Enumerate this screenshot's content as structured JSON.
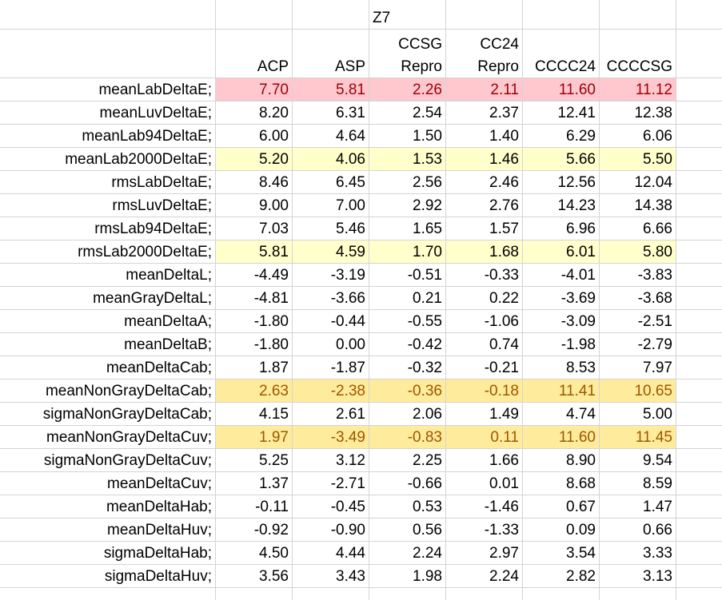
{
  "sheet": {
    "top_header": "Z7",
    "columns": [
      {
        "line1": "",
        "line2": "ACP"
      },
      {
        "line1": "",
        "line2": "ASP"
      },
      {
        "line1": "CCSG",
        "line2": "Repro"
      },
      {
        "line1": "CC24",
        "line2": "Repro"
      },
      {
        "line1": "",
        "line2": "CCCC24"
      },
      {
        "line1": "",
        "line2": "CCCCSG"
      }
    ],
    "rows": [
      {
        "label": "meanLabDeltaE;",
        "highlight": "pink",
        "values": [
          "7.70",
          "5.81",
          "2.26",
          "2.11",
          "11.60",
          "11.12"
        ]
      },
      {
        "label": "meanLuvDeltaE;",
        "highlight": "",
        "values": [
          "8.20",
          "6.31",
          "2.54",
          "2.37",
          "12.41",
          "12.38"
        ]
      },
      {
        "label": "meanLab94DeltaE;",
        "highlight": "",
        "values": [
          "6.00",
          "4.64",
          "1.50",
          "1.40",
          "6.29",
          "6.06"
        ]
      },
      {
        "label": "meanLab2000DeltaE;",
        "highlight": "yellow",
        "values": [
          "5.20",
          "4.06",
          "1.53",
          "1.46",
          "5.66",
          "5.50"
        ]
      },
      {
        "label": "rmsLabDeltaE;",
        "highlight": "",
        "values": [
          "8.46",
          "6.45",
          "2.56",
          "2.46",
          "12.56",
          "12.04"
        ]
      },
      {
        "label": "rmsLuvDeltaE;",
        "highlight": "",
        "values": [
          "9.00",
          "7.00",
          "2.92",
          "2.76",
          "14.23",
          "14.38"
        ]
      },
      {
        "label": "rmsLab94DeltaE;",
        "highlight": "",
        "values": [
          "7.03",
          "5.46",
          "1.65",
          "1.57",
          "6.96",
          "6.66"
        ]
      },
      {
        "label": "rmsLab2000DeltaE;",
        "highlight": "yellow",
        "values": [
          "5.81",
          "4.59",
          "1.70",
          "1.68",
          "6.01",
          "5.80"
        ]
      },
      {
        "label": "meanDeltaL;",
        "highlight": "",
        "values": [
          "-4.49",
          "-3.19",
          "-0.51",
          "-0.33",
          "-4.01",
          "-3.83"
        ]
      },
      {
        "label": "meanGrayDeltaL;",
        "highlight": "",
        "values": [
          "-4.81",
          "-3.66",
          "0.21",
          "0.22",
          "-3.69",
          "-3.68"
        ]
      },
      {
        "label": "meanDeltaA;",
        "highlight": "",
        "values": [
          "-1.80",
          "-0.44",
          "-0.55",
          "-1.06",
          "-3.09",
          "-2.51"
        ]
      },
      {
        "label": "meanDeltaB;",
        "highlight": "",
        "values": [
          "-1.80",
          "0.00",
          "-0.42",
          "0.74",
          "-1.98",
          "-2.79"
        ]
      },
      {
        "label": "meanDeltaCab;",
        "highlight": "",
        "values": [
          "1.87",
          "-1.87",
          "-0.32",
          "-0.21",
          "8.53",
          "7.97"
        ]
      },
      {
        "label": "meanNonGrayDeltaCab;",
        "highlight": "gold",
        "values": [
          "2.63",
          "-2.38",
          "-0.36",
          "-0.18",
          "11.41",
          "10.65"
        ]
      },
      {
        "label": "sigmaNonGrayDeltaCab;",
        "highlight": "",
        "values": [
          "4.15",
          "2.61",
          "2.06",
          "1.49",
          "4.74",
          "5.00"
        ]
      },
      {
        "label": "meanNonGrayDeltaCuv;",
        "highlight": "gold",
        "values": [
          "1.97",
          "-3.49",
          "-0.83",
          "0.11",
          "11.60",
          "11.45"
        ]
      },
      {
        "label": "sigmaNonGrayDeltaCuv;",
        "highlight": "",
        "values": [
          "5.25",
          "3.12",
          "2.25",
          "1.66",
          "8.90",
          "9.54"
        ]
      },
      {
        "label": "meanDeltaCuv;",
        "highlight": "",
        "values": [
          "1.37",
          "-2.71",
          "-0.66",
          "0.01",
          "8.68",
          "8.59"
        ]
      },
      {
        "label": "meanDeltaHab;",
        "highlight": "",
        "values": [
          "-0.11",
          "-0.45",
          "0.53",
          "-1.46",
          "0.67",
          "1.47"
        ]
      },
      {
        "label": "meanDeltaHuv;",
        "highlight": "",
        "values": [
          "-0.92",
          "-0.90",
          "0.56",
          "-1.33",
          "0.09",
          "0.66"
        ]
      },
      {
        "label": "sigmaDeltaHab;",
        "highlight": "",
        "values": [
          "4.50",
          "4.44",
          "2.24",
          "2.97",
          "3.54",
          "3.33"
        ]
      },
      {
        "label": "sigmaDeltaHuv;",
        "highlight": "",
        "values": [
          "3.56",
          "3.43",
          "1.98",
          "2.24",
          "2.82",
          "3.13"
        ]
      }
    ]
  },
  "colors": {
    "gridline": "#d4d4d4",
    "pink_fill": "#ffc7ce",
    "pink_text": "#9c0006",
    "yellow_fill": "#ffffcc",
    "gold_fill": "#ffeb9c",
    "gold_text": "#9c5700"
  }
}
